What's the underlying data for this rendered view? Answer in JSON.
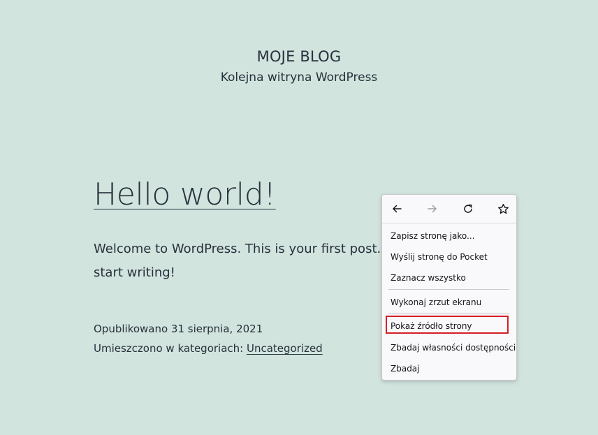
{
  "site": {
    "title": "MOJE BLOG",
    "description": "Kolejna witryna WordPress"
  },
  "post": {
    "title": "Hello world!",
    "body_line1": "Welcome to WordPress. This is your first post. E",
    "body_line2": "start writing!",
    "published": "Opublikowano 31 sierpnia, 2021",
    "categories_prefix": "Umieszczono w kategoriach: ",
    "category": "Uncategorized"
  },
  "context_menu": {
    "nav": {
      "back_icon": "arrow-left-icon",
      "forward_icon": "arrow-right-icon",
      "reload_icon": "reload-icon",
      "bookmark_icon": "star-icon",
      "forward_disabled": true
    },
    "items": [
      {
        "label": "Zapisz stronę jako..."
      },
      {
        "label": "Wyślij stronę do Pocket"
      },
      {
        "label": "Zaznacz wszystko"
      },
      {
        "label": "Wykonaj zrzut ekranu"
      },
      {
        "label": "Pokaż źródło strony",
        "highlighted": true
      },
      {
        "label": "Zbadaj własności dostępności"
      },
      {
        "label": "Zbadaj"
      }
    ],
    "highlight_color": "#d42027"
  },
  "colors": {
    "background": "#d1e4dd",
    "text": "#28303d",
    "menu_background": "#f9f9fb"
  }
}
